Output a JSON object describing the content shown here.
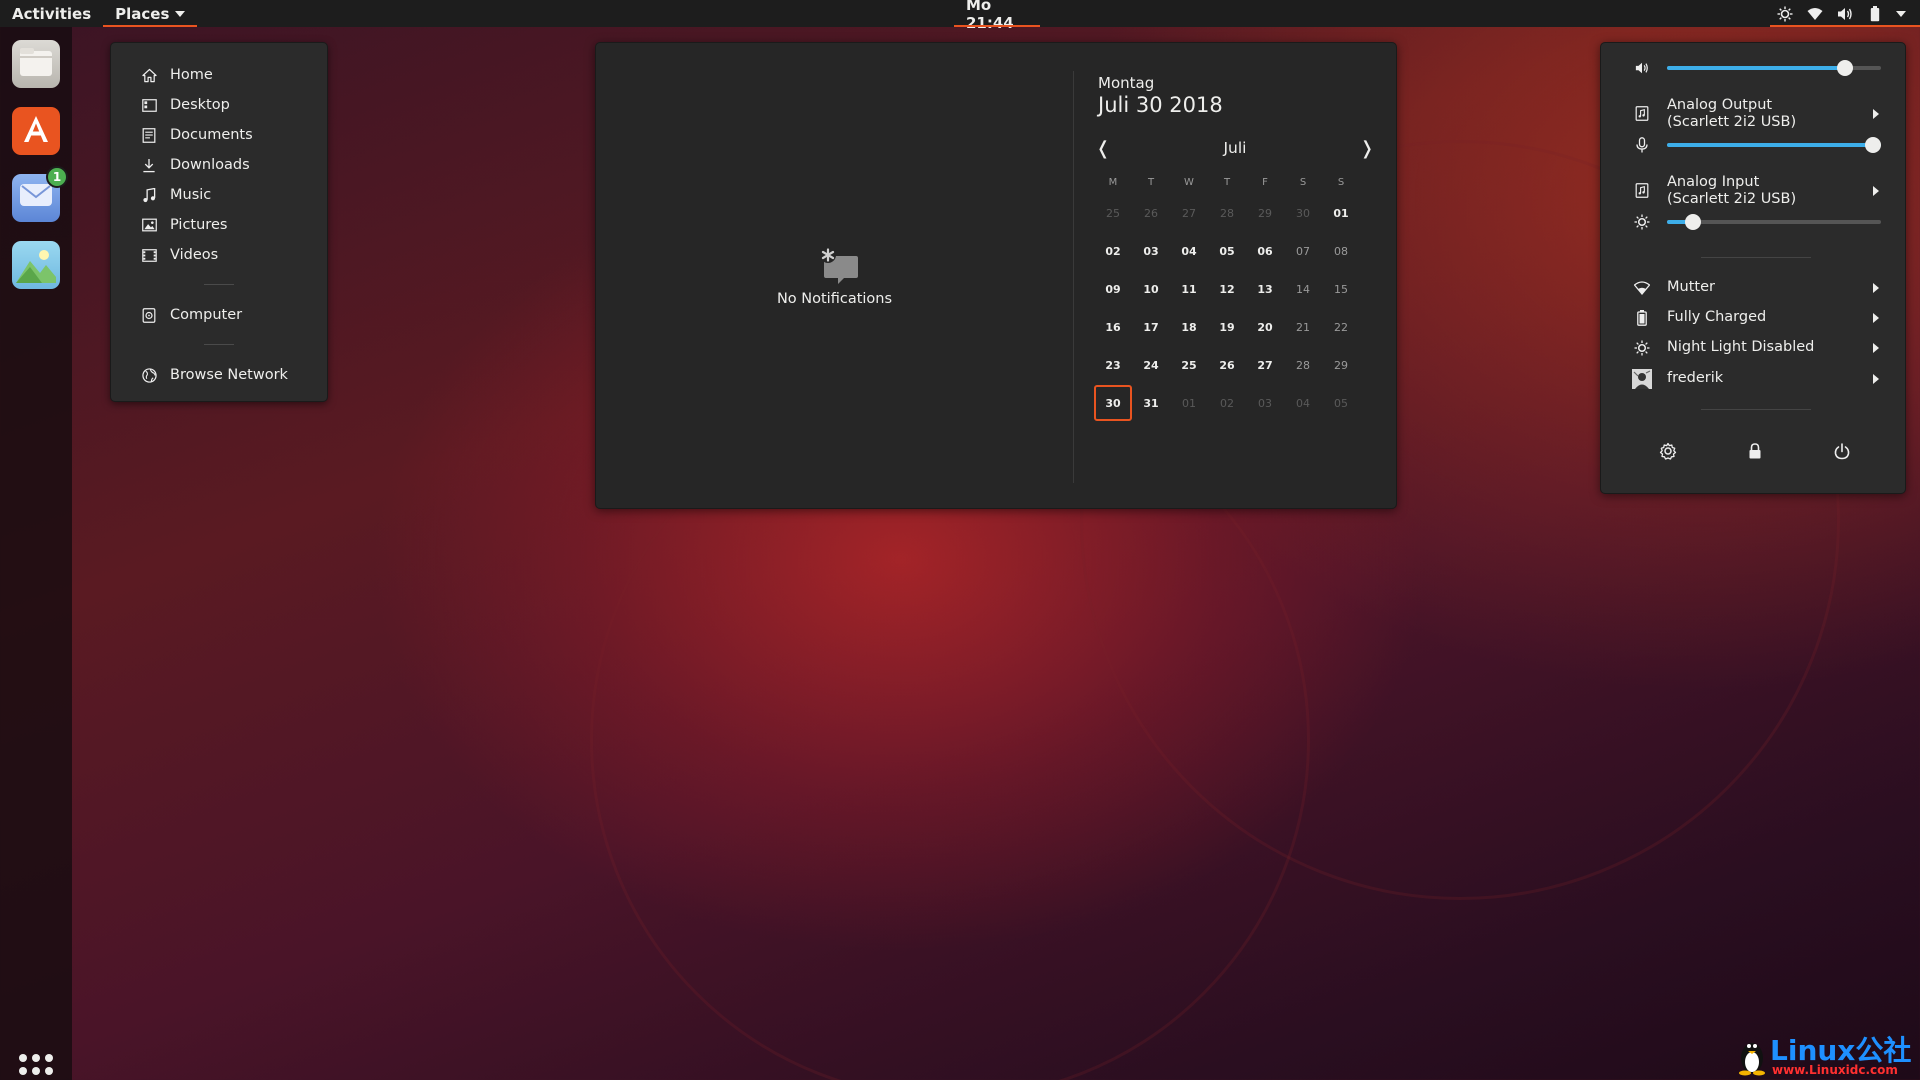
{
  "topbar": {
    "activities_label": "Activities",
    "places_label": "Places",
    "clock": "Mo 21:44"
  },
  "dock": {
    "apps": [
      {
        "name": "Files",
        "icon": "files-icon"
      },
      {
        "name": "Ubuntu Software",
        "icon": "software-center-icon"
      },
      {
        "name": "Mail",
        "icon": "mail-icon",
        "badge": "1"
      },
      {
        "name": "Image Viewer",
        "icon": "image-viewer-icon"
      }
    ]
  },
  "places": {
    "items": [
      {
        "label": "Home",
        "icon": "home-icon"
      },
      {
        "label": "Desktop",
        "icon": "desktop-icon"
      },
      {
        "label": "Documents",
        "icon": "documents-icon"
      },
      {
        "label": "Downloads",
        "icon": "downloads-icon"
      },
      {
        "label": "Music",
        "icon": "music-icon"
      },
      {
        "label": "Pictures",
        "icon": "pictures-icon"
      },
      {
        "label": "Videos",
        "icon": "videos-icon"
      }
    ],
    "computer_label": "Computer",
    "network_label": "Browse Network"
  },
  "notifications": {
    "empty_text": "No Notifications"
  },
  "calendar": {
    "weekday": "Montag",
    "full_date": "Juli 30 2018",
    "month": "Juli",
    "prev_symbol": "❬",
    "next_symbol": "❭",
    "day_headers": [
      "M",
      "T",
      "W",
      "T",
      "F",
      "S",
      "S"
    ],
    "weeks": [
      [
        "25",
        "26",
        "27",
        "28",
        "29",
        "30",
        "01"
      ],
      [
        "02",
        "03",
        "04",
        "05",
        "06",
        "07",
        "08"
      ],
      [
        "09",
        "10",
        "11",
        "12",
        "13",
        "14",
        "15"
      ],
      [
        "16",
        "17",
        "18",
        "19",
        "20",
        "21",
        "22"
      ],
      [
        "23",
        "24",
        "25",
        "26",
        "27",
        "28",
        "29"
      ],
      [
        "30",
        "31",
        "01",
        "02",
        "03",
        "04",
        "05"
      ]
    ],
    "today": "30"
  },
  "system_menu": {
    "volume_level": 0.83,
    "output_label_line1": "Analog Output",
    "output_label_line2": "(Scarlett 2i2 USB)",
    "mic_level": 1.0,
    "input_label_line1": "Analog Input",
    "input_label_line2": "(Scarlett 2i2 USB)",
    "brightness_level": 0.12,
    "wifi_label": "Mutter",
    "battery_label": "Fully Charged",
    "night_light_label": "Night Light Disabled",
    "user_label": "frederik"
  },
  "watermark": {
    "brand": "Linux公社",
    "url": "www.Linuxidc.com"
  },
  "colors": {
    "accent": "#e95420",
    "panel_bg": "#2b2b2b",
    "topbar_bg": "#1d1d1d",
    "slider_fill": "#3daee9"
  }
}
